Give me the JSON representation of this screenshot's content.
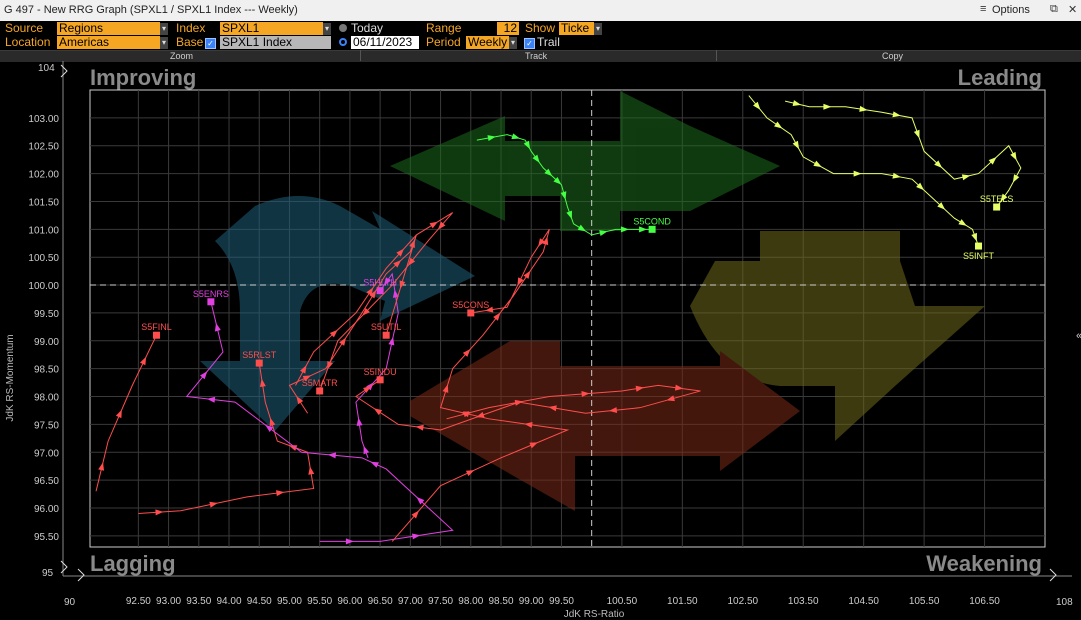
{
  "window": {
    "title": "G 497 - New RRG Graph (SPXL1 / SPXL1 Index --- Weekly)",
    "options_label": "Options",
    "pin_icon": "pin-icon",
    "close_icon": "close-icon"
  },
  "controls": {
    "source_label": "Source",
    "source_value": "Regions",
    "location_label": "Location",
    "location_value": "Americas",
    "index_label": "Index",
    "index_value": "SPXL1",
    "base_label": "Base",
    "base_value": "SPXL1 Index",
    "today_label": "Today",
    "date_value": "06/11/2023",
    "range_label": "Range",
    "range_value": "12",
    "period_label": "Period",
    "period_value": "Weekly",
    "show_label": "Show",
    "show_value": "Ticke",
    "trail_label": "Trail"
  },
  "toolbar": {
    "zoom": "Zoom",
    "track": "Track",
    "copy": "Copy"
  },
  "quadrants": {
    "improving": "Improving",
    "leading": "Leading",
    "lagging": "Lagging",
    "weakening": "Weakening"
  },
  "colors": {
    "improving_arrow": "#1f5f7a",
    "leading_arrow": "#1d6b1d",
    "weakening_arrow": "#6e6a1a",
    "lagging_arrow": "#7a2a17",
    "red_series": "#ff4d4d",
    "magenta_series": "#e040e0",
    "green_series": "#44ff44",
    "yellow_series": "#e6ff66",
    "grid": "#3a3a3a",
    "plot_border": "#cccccc"
  },
  "chart_data": {
    "type": "scatter",
    "xlabel": "JdK RS-Ratio",
    "ylabel": "JdK RS-Momentum",
    "xlim": [
      91.7,
      107.5
    ],
    "ylim": [
      95.3,
      103.5
    ],
    "x_edge_labels": [
      "90",
      "108"
    ],
    "y_edge_labels": [
      "104",
      "95"
    ],
    "x_ticks": [
      "92.50",
      "93.00",
      "93.50",
      "94.00",
      "94.50",
      "95.00",
      "95.50",
      "96.00",
      "96.50",
      "97.00",
      "97.50",
      "98.00",
      "98.50",
      "99.00",
      "99.50",
      "100.50",
      "101.50",
      "102.50",
      "103.50",
      "104.50",
      "105.50",
      "106.50"
    ],
    "y_ticks": [
      "103.00",
      "102.50",
      "102.00",
      "101.50",
      "101.00",
      "100.50",
      "100.00",
      "99.50",
      "99.00",
      "98.50",
      "98.00",
      "97.50",
      "97.00",
      "96.50",
      "96.00",
      "95.50"
    ],
    "center": [
      100,
      100
    ],
    "series": [
      {
        "name": "S5FINL",
        "color": "red",
        "points": [
          [
            91.8,
            96.3
          ],
          [
            92.0,
            97.2
          ],
          [
            92.4,
            98.2
          ],
          [
            92.8,
            99.1
          ]
        ]
      },
      {
        "name": "S5RLST",
        "color": "red",
        "points": [
          [
            92.5,
            95.9
          ],
          [
            93.2,
            95.95
          ],
          [
            94.3,
            96.2
          ],
          [
            95.4,
            96.35
          ],
          [
            95.3,
            97.0
          ],
          [
            94.8,
            97.2
          ],
          [
            94.6,
            97.9
          ],
          [
            94.5,
            98.6
          ]
        ]
      },
      {
        "name": "S5ENRS",
        "color": "magenta",
        "points": [
          [
            95.5,
            95.4
          ],
          [
            96.5,
            95.4
          ],
          [
            97.7,
            95.6
          ],
          [
            96.6,
            96.7
          ],
          [
            96.2,
            96.9
          ],
          [
            95.2,
            97.0
          ],
          [
            94.1,
            97.9
          ],
          [
            93.3,
            98.0
          ],
          [
            93.9,
            98.8
          ],
          [
            93.7,
            99.7
          ]
        ]
      },
      {
        "name": "S5HLTH",
        "color": "magenta",
        "points": [
          [
            96.3,
            96.9
          ],
          [
            96.2,
            97.2
          ],
          [
            96.1,
            97.9
          ],
          [
            96.6,
            98.5
          ],
          [
            96.8,
            99.5
          ],
          [
            96.7,
            100.2
          ],
          [
            96.5,
            99.9
          ]
        ]
      },
      {
        "name": "S5UTIL",
        "color": "red",
        "points": [
          [
            95.3,
            97.7
          ],
          [
            95.0,
            98.2
          ],
          [
            95.6,
            98.5
          ],
          [
            96.2,
            99.5
          ],
          [
            96.6,
            100.2
          ],
          [
            97.0,
            100.6
          ],
          [
            97.1,
            100.9
          ],
          [
            96.6,
            99.1
          ]
        ]
      },
      {
        "name": "S5MATR",
        "color": "red",
        "points": [
          [
            95.1,
            98.2
          ],
          [
            95.4,
            98.8
          ],
          [
            96.1,
            99.5
          ],
          [
            96.6,
            100.3
          ],
          [
            97.1,
            100.9
          ],
          [
            97.7,
            101.3
          ],
          [
            97.3,
            100.8
          ],
          [
            96.7,
            100.0
          ],
          [
            95.8,
            99.0
          ],
          [
            95.5,
            98.1
          ]
        ]
      },
      {
        "name": "S5INDU",
        "color": "red",
        "points": [
          [
            97.6,
            97.6
          ],
          [
            98.3,
            97.8
          ],
          [
            99.3,
            98.0
          ],
          [
            100.5,
            98.1
          ],
          [
            101.1,
            98.2
          ],
          [
            101.8,
            98.1
          ],
          [
            100.8,
            97.8
          ],
          [
            99.9,
            97.7
          ],
          [
            98.8,
            97.9
          ],
          [
            97.5,
            97.4
          ],
          [
            96.8,
            97.5
          ],
          [
            96.1,
            98.0
          ],
          [
            96.5,
            98.3
          ]
        ]
      },
      {
        "name": "S5CONS",
        "color": "red",
        "points": [
          [
            96.7,
            95.4
          ],
          [
            97.5,
            96.4
          ],
          [
            98.5,
            96.9
          ],
          [
            99.6,
            97.4
          ],
          [
            98.3,
            97.6
          ],
          [
            97.5,
            97.8
          ],
          [
            97.7,
            98.5
          ],
          [
            98.2,
            99.1
          ],
          [
            98.7,
            99.8
          ],
          [
            99.2,
            100.6
          ],
          [
            99.3,
            101.0
          ],
          [
            99.0,
            100.5
          ],
          [
            98.6,
            99.6
          ],
          [
            98.0,
            99.5
          ]
        ]
      },
      {
        "name": "S5COND",
        "color": "green",
        "points": [
          [
            98.1,
            102.6
          ],
          [
            98.6,
            102.7
          ],
          [
            98.9,
            102.6
          ],
          [
            99.0,
            102.4
          ],
          [
            99.2,
            102.1
          ],
          [
            99.4,
            101.9
          ],
          [
            99.5,
            101.8
          ],
          [
            99.6,
            101.4
          ],
          [
            99.7,
            101.1
          ],
          [
            100.0,
            100.9
          ],
          [
            100.4,
            101.0
          ],
          [
            100.7,
            101.0
          ],
          [
            101.0,
            101.0
          ]
        ]
      },
      {
        "name": "S5TELS",
        "color": "yellow",
        "points": [
          [
            103.2,
            103.3
          ],
          [
            103.6,
            103.2
          ],
          [
            104.2,
            103.2
          ],
          [
            104.8,
            103.1
          ],
          [
            105.3,
            103.0
          ],
          [
            105.5,
            102.4
          ],
          [
            106.0,
            101.9
          ],
          [
            106.4,
            102.0
          ],
          [
            106.9,
            102.5
          ],
          [
            107.1,
            102.1
          ],
          [
            106.9,
            101.7
          ],
          [
            106.7,
            101.4
          ]
        ]
      },
      {
        "name": "S5INFT",
        "color": "yellow",
        "points": [
          [
            102.6,
            103.4
          ],
          [
            102.9,
            103.0
          ],
          [
            103.3,
            102.7
          ],
          [
            103.5,
            102.3
          ],
          [
            104.0,
            102.0
          ],
          [
            104.8,
            102.0
          ],
          [
            105.3,
            101.9
          ],
          [
            105.6,
            101.6
          ],
          [
            106.0,
            101.2
          ],
          [
            106.3,
            101.0
          ],
          [
            106.4,
            100.7
          ]
        ]
      }
    ]
  }
}
